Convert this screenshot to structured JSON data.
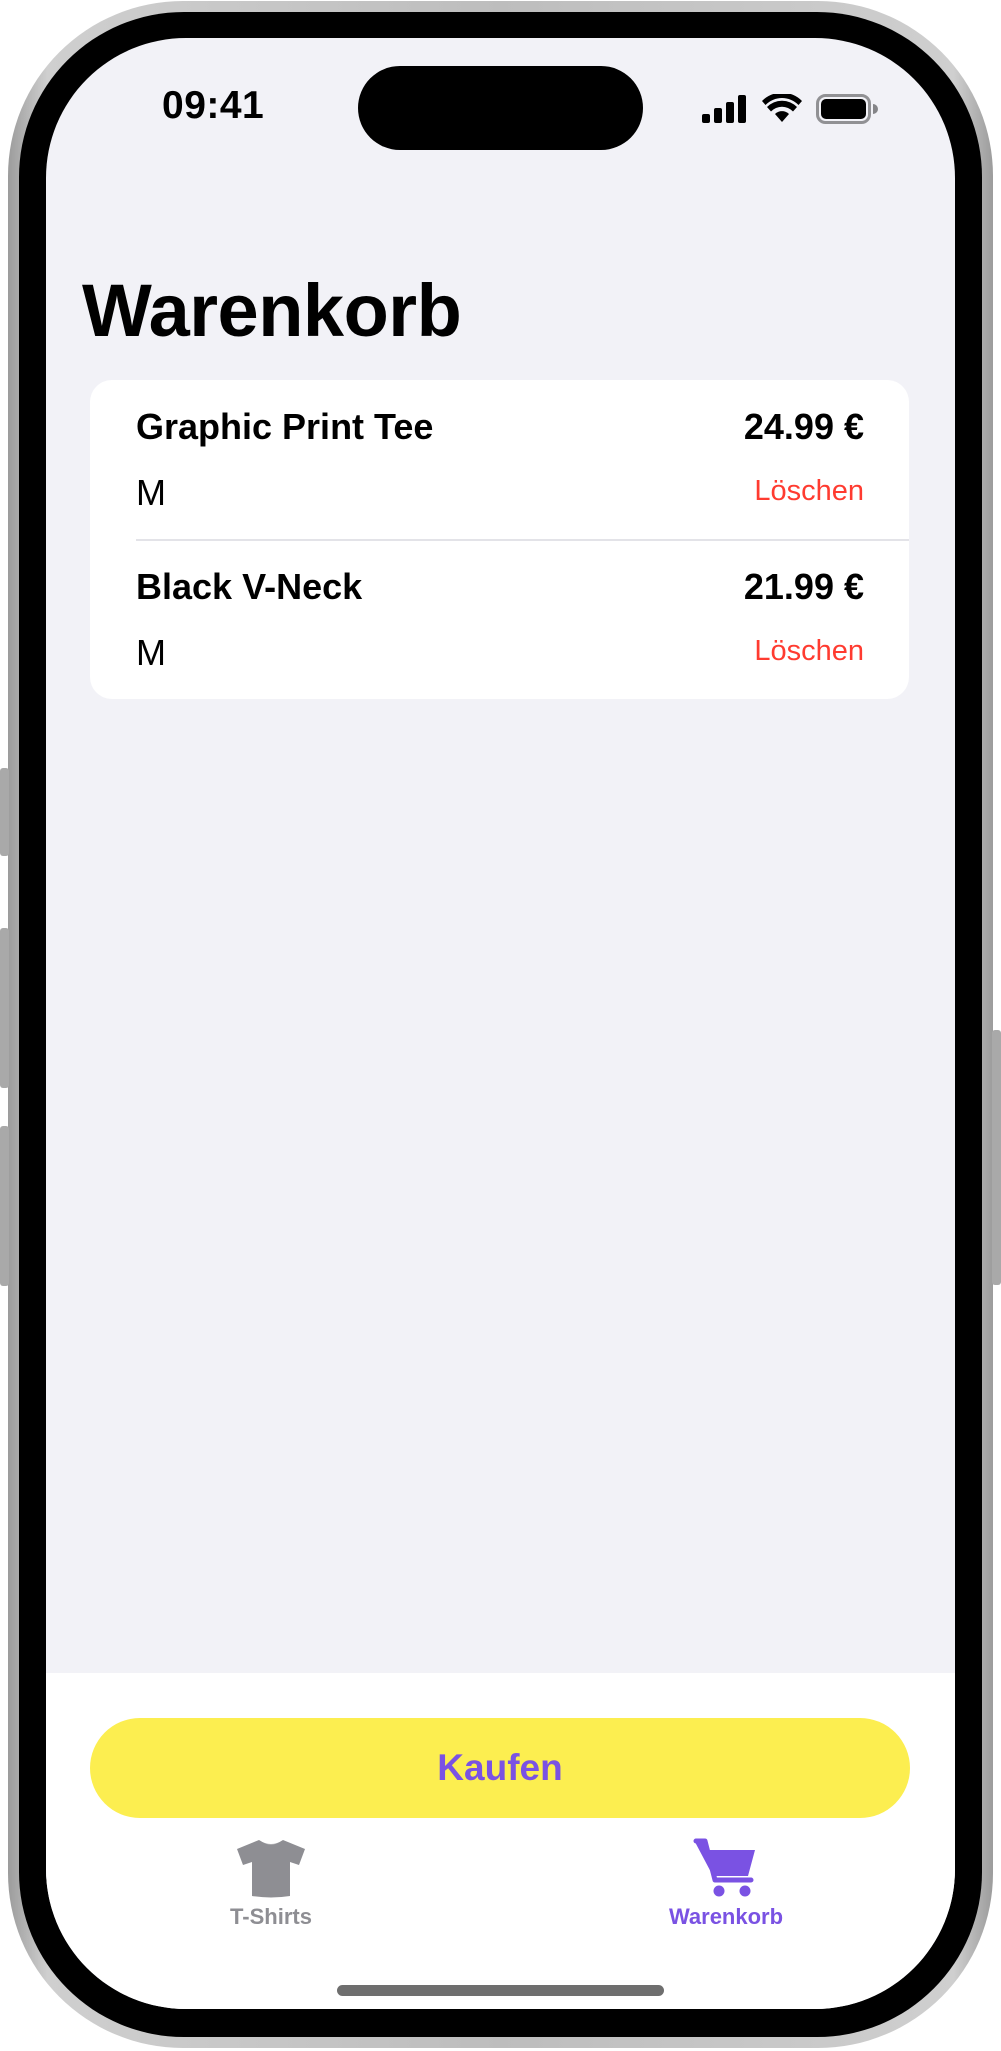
{
  "status_bar": {
    "time": "09:41",
    "icons": [
      "cellular-signal-icon",
      "wifi-icon",
      "battery-icon"
    ]
  },
  "page": {
    "title": "Warenkorb"
  },
  "cart": {
    "items": [
      {
        "name": "Graphic Print Tee",
        "price": "24.99 €",
        "size": "M",
        "delete_label": "Löschen"
      },
      {
        "name": "Black V-Neck",
        "price": "21.99 €",
        "size": "M",
        "delete_label": "Löschen"
      }
    ]
  },
  "actions": {
    "buy_label": "Kaufen"
  },
  "tab_bar": {
    "tabs": [
      {
        "label": "T-Shirts",
        "icon": "tshirt-icon",
        "active": false
      },
      {
        "label": "Warenkorb",
        "icon": "cart-icon",
        "active": true
      }
    ]
  },
  "colors": {
    "accent": "#7a52e3",
    "buy_button": "#fcee50",
    "delete": "#ff3b30",
    "inactive_tab": "#8e8e93",
    "background": "#f2f2f7"
  }
}
